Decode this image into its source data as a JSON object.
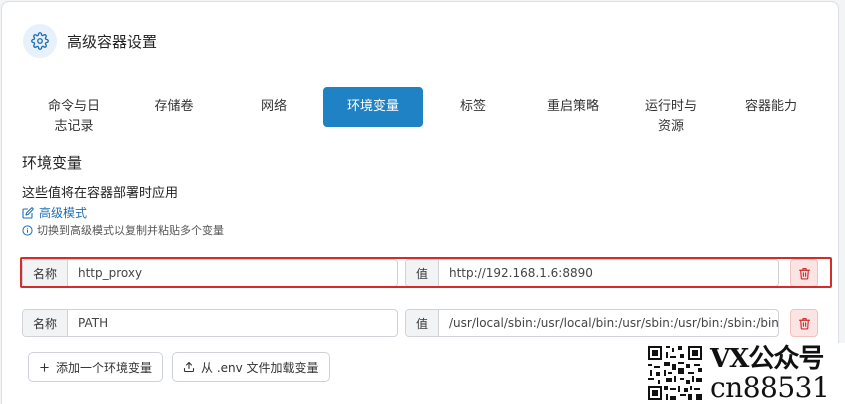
{
  "header": {
    "title": "高级容器设置",
    "icon": "gear-icon"
  },
  "tabs": [
    {
      "label": "命令与日\n志记录"
    },
    {
      "label": "存储卷"
    },
    {
      "label": "网络"
    },
    {
      "label": "环境变量",
      "active": true
    },
    {
      "label": "标签"
    },
    {
      "label": "重启策略"
    },
    {
      "label": "运行时与\n资源"
    },
    {
      "label": "容器能力"
    }
  ],
  "section": {
    "title": "环境变量",
    "description": "这些值将在容器部署时应用",
    "advanced_mode_label": "高级模式",
    "hint": "切换到高级模式以复制并粘贴多个变量"
  },
  "env_vars": [
    {
      "name_label": "名称",
      "name": "http_proxy",
      "value_label": "值",
      "value": "http://192.168.1.6:8890",
      "highlighted": true
    },
    {
      "name_label": "名称",
      "name": "PATH",
      "value_label": "值",
      "value": "/usr/local/sbin:/usr/local/bin:/usr/sbin:/usr/bin:/sbin:/bin",
      "highlighted": false
    }
  ],
  "buttons": {
    "add_label": "添加一个环境变量",
    "load_env_label": "从 .env 文件加载变量"
  },
  "watermark": {
    "line1": "VX公众号",
    "line2": "cn88531"
  },
  "colors": {
    "accent": "#1f82c4",
    "danger": "#d62b2b",
    "link": "#1f6fb3"
  }
}
